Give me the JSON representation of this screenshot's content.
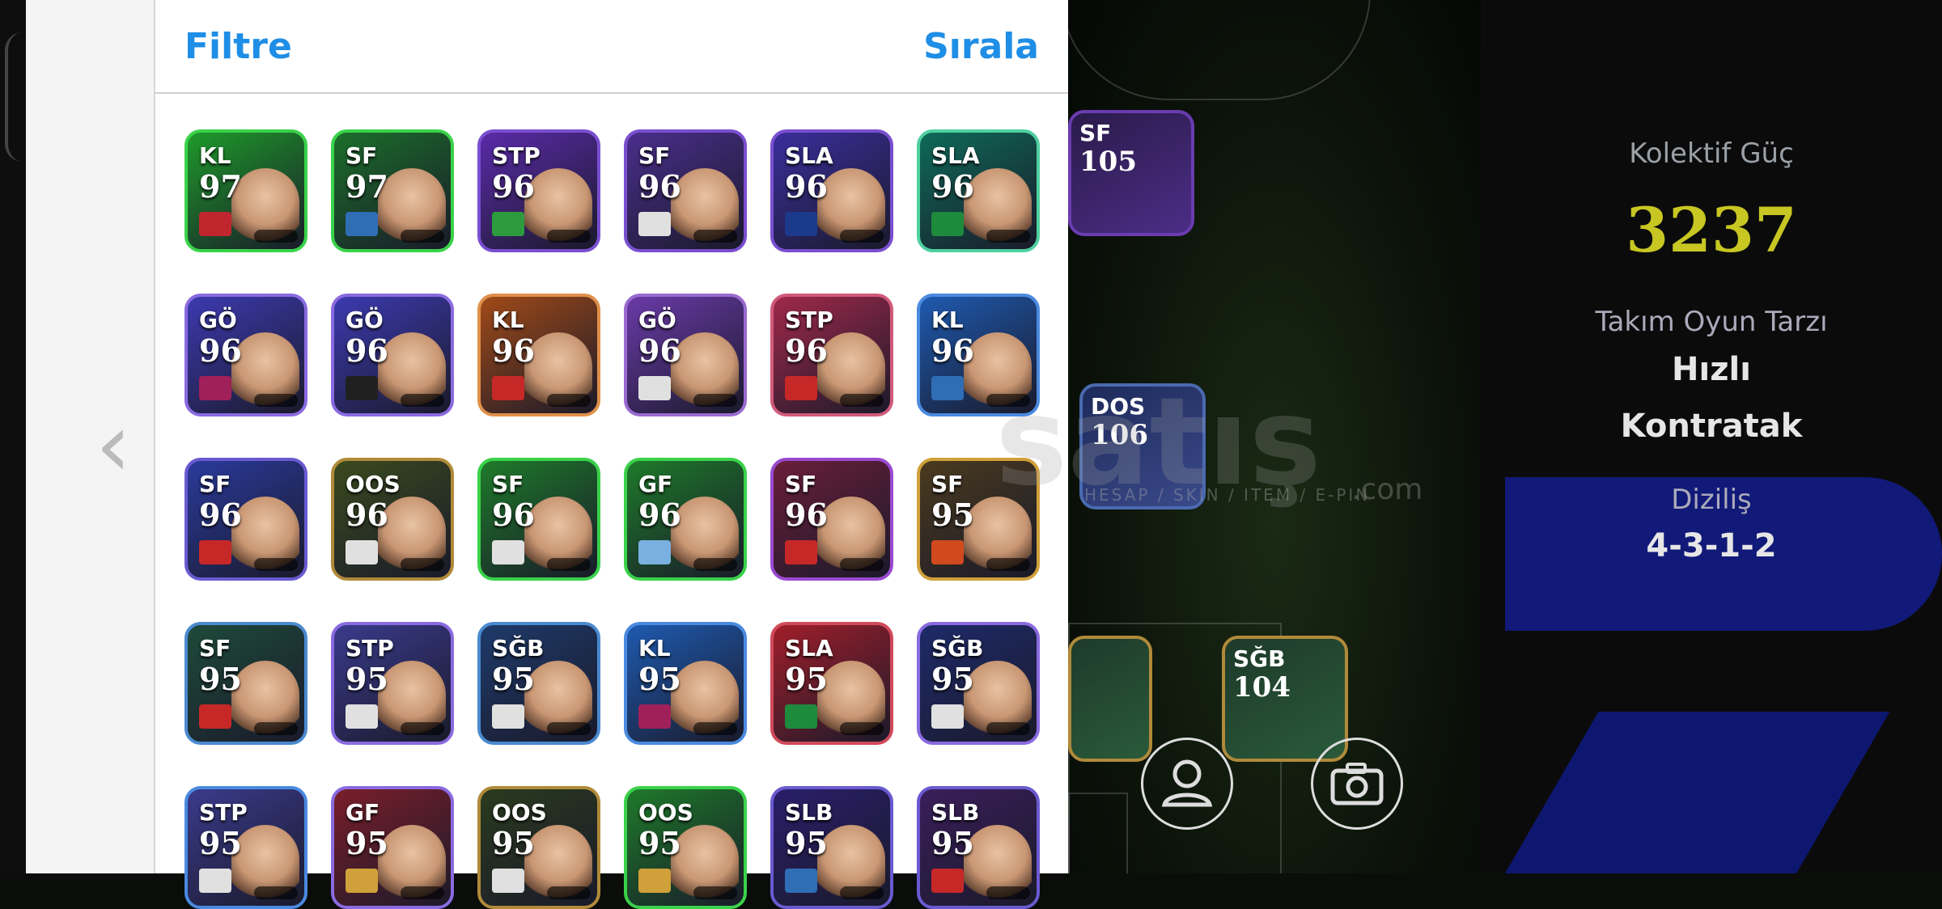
{
  "header": {
    "filter_label": "Filtre",
    "sort_label": "Sırala"
  },
  "cards": [
    {
      "position": "KL",
      "rating": "97",
      "bg": "#1e9a2a",
      "border": "#3ad24a",
      "badge": "#c0262d"
    },
    {
      "position": "SF",
      "rating": "97",
      "bg": "#1b6e2a",
      "border": "#3ad24a",
      "badge": "#2f6db5"
    },
    {
      "position": "STP",
      "rating": "96",
      "bg": "#5a2aa8",
      "border": "#7a4fd0",
      "badge": "#2e9a3e"
    },
    {
      "position": "SF",
      "rating": "96",
      "bg": "#4a2e8c",
      "border": "#7a4fd0",
      "badge": "#e0e0e0"
    },
    {
      "position": "SLA",
      "rating": "96",
      "bg": "#3a2e9c",
      "border": "#7a4fd0",
      "badge": "#1c3a8c"
    },
    {
      "position": "SLA",
      "rating": "96",
      "bg": "#0e6a58",
      "border": "#4fd0a0",
      "badge": "#1e8a3c"
    },
    {
      "position": "GÖ",
      "rating": "96",
      "bg": "#3c3ab0",
      "border": "#8a6ae0",
      "badge": "#a0205a"
    },
    {
      "position": "GÖ",
      "rating": "96",
      "bg": "#3c3ab0",
      "border": "#8a6ae0",
      "badge": "#202020"
    },
    {
      "position": "KL",
      "rating": "96",
      "bg": "#a04a18",
      "border": "#e0904a",
      "badge": "#c62828"
    },
    {
      "position": "GÖ",
      "rating": "96",
      "bg": "#6a3aa8",
      "border": "#9a6ad0",
      "badge": "#e0e0e0"
    },
    {
      "position": "STP",
      "rating": "96",
      "bg": "#a0284a",
      "border": "#d05a7a",
      "badge": "#c62828"
    },
    {
      "position": "KL",
      "rating": "96",
      "bg": "#1e5ab0",
      "border": "#4a8ae0",
      "badge": "#2f6db5"
    },
    {
      "position": "SF",
      "rating": "96",
      "bg": "#2a3a9c",
      "border": "#6a5ad0",
      "badge": "#c62828"
    },
    {
      "position": "OOS",
      "rating": "96",
      "bg": "#3a4a1e",
      "border": "#b08a3a",
      "badge": "#e0e0e0"
    },
    {
      "position": "SF",
      "rating": "96",
      "bg": "#1e7a2a",
      "border": "#3ad24a",
      "badge": "#e0e0e0"
    },
    {
      "position": "GF",
      "rating": "96",
      "bg": "#1e7a2a",
      "border": "#3ad24a",
      "badge": "#7ab0e0"
    },
    {
      "position": "SF",
      "rating": "96",
      "bg": "#6a1e3a",
      "border": "#9a4ad0",
      "badge": "#c62828"
    },
    {
      "position": "SF",
      "rating": "95",
      "bg": "#4a3a1e",
      "border": "#d0a03a",
      "badge": "#d04a1e"
    },
    {
      "position": "SF",
      "rating": "95",
      "bg": "#1e4a3a",
      "border": "#4a8ad0",
      "badge": "#c62828"
    },
    {
      "position": "STP",
      "rating": "95",
      "bg": "#3a3a8c",
      "border": "#8a6ae0",
      "badge": "#e0e0e0"
    },
    {
      "position": "SĞB",
      "rating": "95",
      "bg": "#1e3a6a",
      "border": "#4a8ad0",
      "badge": "#e0e0e0"
    },
    {
      "position": "KL",
      "rating": "95",
      "bg": "#1e5ab0",
      "border": "#4a8ae0",
      "badge": "#a0205a"
    },
    {
      "position": "SLA",
      "rating": "95",
      "bg": "#a01e2a",
      "border": "#d04a5a",
      "badge": "#1e8a3c"
    },
    {
      "position": "SĞB",
      "rating": "95",
      "bg": "#1e2a6a",
      "border": "#8a6ae0",
      "badge": "#e0e0e0"
    },
    {
      "position": "STP",
      "rating": "95",
      "bg": "#3a3a8c",
      "border": "#4a8ae0",
      "badge": "#e0e0e0"
    },
    {
      "position": "GF",
      "rating": "95",
      "bg": "#7a1e2a",
      "border": "#8a6ae0",
      "badge": "#d0a03a"
    },
    {
      "position": "OOS",
      "rating": "95",
      "bg": "#2a3a1e",
      "border": "#b08a3a",
      "badge": "#e0e0e0"
    },
    {
      "position": "OOS",
      "rating": "95",
      "bg": "#1e7a2a",
      "border": "#3ad24a",
      "badge": "#d0a03a"
    },
    {
      "position": "SLB",
      "rating": "95",
      "bg": "#2a1e6a",
      "border": "#6a5ad0",
      "badge": "#2f6db5"
    },
    {
      "position": "SLB",
      "rating": "95",
      "bg": "#3a1e5a",
      "border": "#6a5ad0",
      "badge": "#c62828"
    }
  ],
  "field_cards": [
    {
      "position": "SF",
      "rating": "105"
    },
    {
      "position": "DOS",
      "rating": "106"
    },
    {
      "position": "SĞB",
      "rating": "104"
    }
  ],
  "stats": {
    "collective_power_label": "Kolektif Güç",
    "collective_power_value": "3237",
    "play_style_label": "Takım Oyun Tarzı",
    "play_style_line1": "Hızlı",
    "play_style_line2": "Kontratak",
    "formation_label": "Diziliş",
    "formation_value": "4-3-1-2"
  },
  "watermark": {
    "main": "satış",
    "sub": "HESAP / SKIN / ITEM / E-PIN",
    "suffix": ".com"
  },
  "icons": {
    "back": "chevron-left-icon",
    "profile": "person-icon",
    "camera": "camera-icon"
  }
}
